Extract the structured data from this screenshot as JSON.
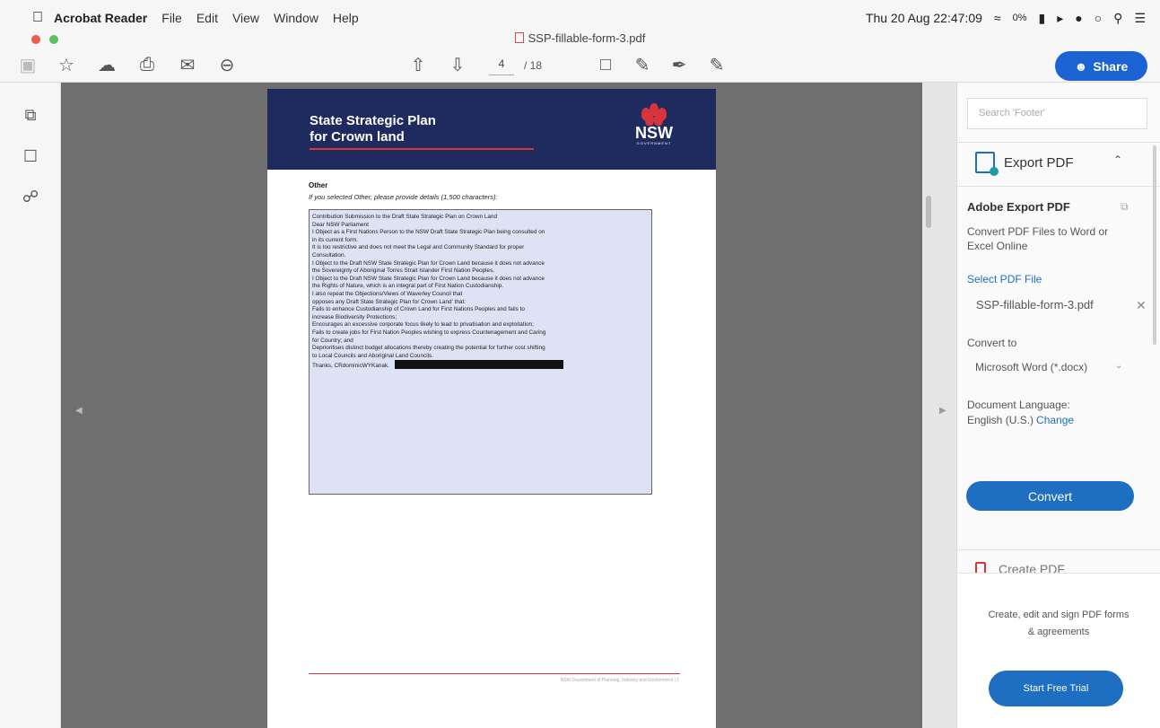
{
  "menubar": {
    "app_name": "Acrobat Reader",
    "items": [
      "File",
      "Edit",
      "View",
      "Window",
      "Help"
    ],
    "clock": "Thu 20 Aug  22:47:09",
    "battery": "0%"
  },
  "window": {
    "title": "SSP-fillable-form-3.pdf"
  },
  "toolbar": {
    "page_current": "4",
    "page_total": "/ 18",
    "share_label": "Share"
  },
  "document": {
    "header_title_line1": "State Strategic Plan",
    "header_title_line2": "for Crown land",
    "logo_text": "NSW",
    "logo_subtext": "GOVERNMENT",
    "question_label": "Other",
    "question_hint": "If you selected Other, please provide details (1,500 characters):",
    "answer_lines": [
      "Contribution Submission to the Draft State Strategic Plan on Crown Land",
      "Dear NSW Parliament",
      "I Object as a First Nations Person to the NSW Draft State Strategic Plan being consulted on",
      "in its current form.",
      "It is too restrictive and does not meet the Legal and Community Standard for proper",
      "Consultation.",
      "I Object to the Draft NSW State Strategic Plan for Crown Land because it does not advance",
      "the Sovereignty of Aboriginal Torres Strait Islander First Nation Peoples.",
      "I Object to the Draft NSW  State Strategic Plan for Crown Land because it does not advance",
      "the Rights of Nature, which is an integral part of First Nation Custodianship.",
      "I also repeat the Objections/Views of Waverley Council that",
      "opposes any Draft State Strategic Plan for Crown Land' that:",
      "Fails to enhance Custodianship of Crown Land for First Nations Peoples and fails to",
      "increase Biodiversity Protections;",
      "Encourages an excessive corporate focus likely to lead to privatisation and exploitation;",
      "Fails to create jobs for First Nation Peoples wishing to express Countenagement and Caring",
      "for Country; and",
      "Deprioritises distinct budget allocations thereby creating the potential for further cost shifting",
      "to Local Councils and Aboriginal Land Councils.",
      "Thanks, CRdominicWYKanak."
    ],
    "footer_text": "NSW Department of Planning, Industry and Environment | 1"
  },
  "right_panel": {
    "search_placeholder": "Search 'Footer'",
    "export_label": "Export PDF",
    "section_title": "Adobe Export PDF",
    "description": "Convert PDF Files to Word or Excel Online",
    "select_link": "Select PDF File",
    "file_name": "SSP-fillable-form-3.pdf",
    "convert_to_label": "Convert to",
    "format_value": "Microsoft Word (*.docx)",
    "language_label": "Document Language:",
    "language_value": "English (U.S.)",
    "change_link": "Change",
    "convert_button": "Convert",
    "create_label": "Create PDF",
    "promo_text": "Create, edit and sign PDF forms & agreements",
    "trial_button": "Start Free Trial"
  },
  "colors": {
    "accent": "#1e6fc2",
    "header_navy": "#1f2a5e",
    "nsw_red": "#d7353b",
    "viewer_gray": "#6f6f6f"
  }
}
